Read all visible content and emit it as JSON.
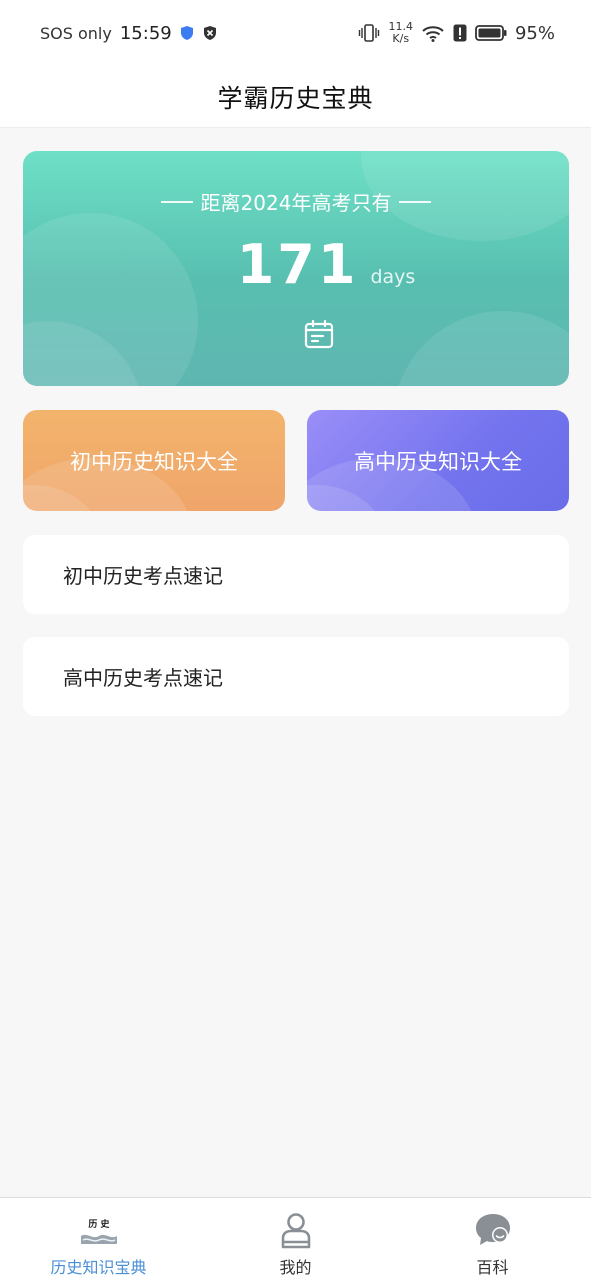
{
  "status_bar": {
    "carrier": "SOS only",
    "time": "15:59",
    "speed_value": "11.4",
    "speed_unit": "K/s",
    "battery": "95%"
  },
  "header": {
    "title": "学霸历史宝典"
  },
  "countdown": {
    "label": "距离2024年高考只有",
    "days": "171",
    "unit": "days",
    "icon": "calendar-icon"
  },
  "quick_buttons": [
    {
      "label": "初中历史知识大全",
      "color": "#f0a86a"
    },
    {
      "label": "高中历史知识大全",
      "color": "#7b78f0"
    }
  ],
  "list": [
    {
      "label": "初中历史考点速记"
    },
    {
      "label": "高中历史考点速记"
    }
  ],
  "tabbar": {
    "active_color": "#4a8fd6",
    "tabs": [
      {
        "label": "历史知识宝典",
        "icon": "history-book-icon",
        "logo_text": "历 史",
        "active": true
      },
      {
        "label": "我的",
        "icon": "user-icon",
        "active": false
      },
      {
        "label": "百科",
        "icon": "chat-bubble-icon",
        "active": false
      }
    ]
  }
}
